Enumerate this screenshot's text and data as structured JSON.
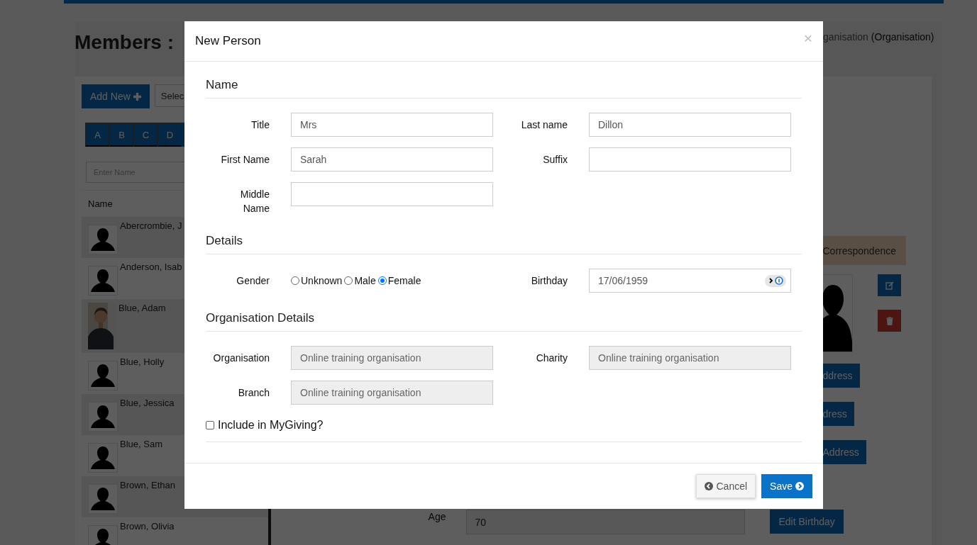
{
  "background": {
    "title": "Members :",
    "org_text": "ganisation",
    "org_name": "(Organisation)",
    "add_button": "Add New",
    "select_text": "Selec",
    "letters": [
      "A",
      "B",
      "C",
      "D"
    ],
    "search": {
      "placeholder": "Enter Name"
    },
    "table": {
      "columns": [
        "Name"
      ],
      "rows": [
        {
          "name": "Abercrombie, J",
          "kind": "silhouette"
        },
        {
          "name": "Anderson, Isab",
          "kind": "silhouette"
        },
        {
          "name": "Blue, Adam",
          "kind": "picture"
        },
        {
          "name": "Blue, Holly",
          "kind": "silhouette"
        },
        {
          "name": "Blue, Jessica",
          "kind": "silhouette"
        },
        {
          "name": "Blue, Sam",
          "kind": "silhouette"
        },
        {
          "name": "Brown, Ethan",
          "kind": "silhouette"
        },
        {
          "name": "Brown, Olivia",
          "kind": "silhouette"
        }
      ]
    },
    "tab": "Correspondence",
    "address_buttons": [
      "ddress",
      "dress",
      "Address"
    ],
    "age": {
      "label": "Age",
      "value": "70"
    },
    "edit_birthday": "Edit Birthday"
  },
  "modal": {
    "title": "New Person",
    "close": "×",
    "sections": [
      {
        "heading": "Name",
        "fields": [
          {
            "label": "Title",
            "kind": "text",
            "value": "Mrs"
          },
          {
            "label": "Last name",
            "kind": "text",
            "value": "Dillon"
          },
          {
            "label": "First Name",
            "kind": "text",
            "value": "Sarah"
          },
          {
            "label": "Suffix",
            "kind": "text"
          },
          {
            "label": "Middle Name",
            "kind": "text"
          }
        ]
      },
      {
        "heading": "Details",
        "fields": [
          {
            "label": "Gender",
            "kind": "radio",
            "options": [
              {
                "label": "Unknown",
                "selected": false
              },
              {
                "label": "Male",
                "selected": false
              },
              {
                "label": "Female",
                "selected": true
              }
            ]
          },
          {
            "label": "Birthday",
            "kind": "date",
            "value": "17/06/1959"
          }
        ]
      },
      {
        "heading": "Organisation Details",
        "fields": [
          {
            "label": "Organisation",
            "kind": "readonly",
            "value": "Online training organisation"
          },
          {
            "label": "Charity",
            "kind": "readonly",
            "value": "Online training organisation"
          },
          {
            "label": "Branch",
            "kind": "readonly",
            "value": "Online training organisation"
          }
        ]
      }
    ],
    "include": {
      "label": "Include in MyGiving?",
      "checked": false
    },
    "buttons": [
      {
        "label": "Cancel",
        "kind": "cancel"
      },
      {
        "label": "Save",
        "kind": "save"
      }
    ]
  }
}
